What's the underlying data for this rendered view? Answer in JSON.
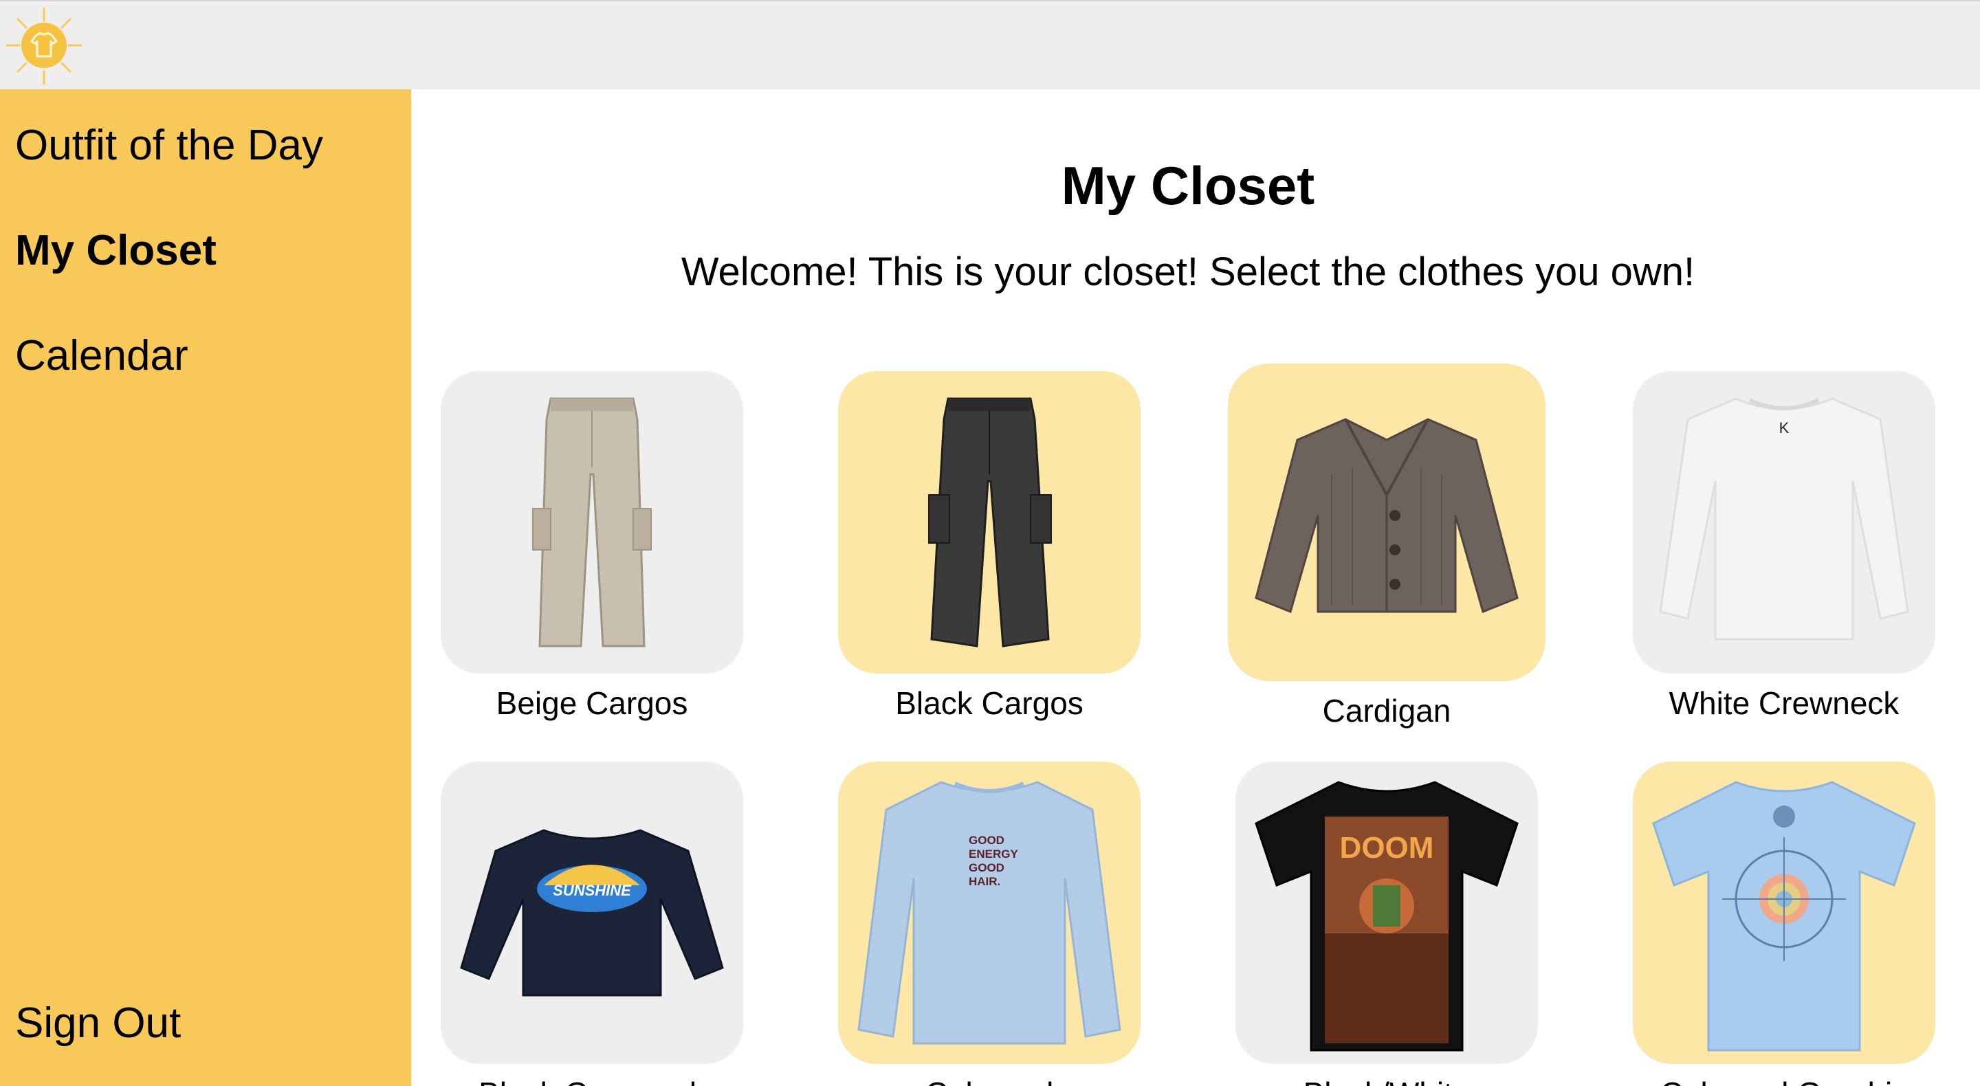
{
  "app": {
    "logo_icon": "sun-shirt-logo-icon"
  },
  "colors": {
    "sidebar": "#f8c958",
    "topbar": "#eeeeee",
    "tile_default": "#eeeeee",
    "tile_selected": "#fce7a6"
  },
  "sidebar": {
    "items": [
      {
        "label": "Outfit of the Day",
        "active": false
      },
      {
        "label": "My Closet",
        "active": true
      },
      {
        "label": "Calendar",
        "active": false
      }
    ],
    "signout_label": "Sign Out"
  },
  "main": {
    "title": "My Closet",
    "subtitle": "Welcome! This is your closet! Select the clothes you own!"
  },
  "closet": {
    "items": [
      {
        "label": "Beige Cargos",
        "selected": false,
        "icon": "beige-cargo-pants-icon"
      },
      {
        "label": "Black Cargos",
        "selected": true,
        "icon": "black-cargo-pants-icon"
      },
      {
        "label": "Cardigan",
        "selected": true,
        "icon": "brown-cardigan-icon"
      },
      {
        "label": "White Crewneck",
        "selected": false,
        "icon": "white-crewneck-icon"
      },
      {
        "label": "Black Crewneck",
        "selected": false,
        "icon": "black-crewneck-icon"
      },
      {
        "label": "Coloured",
        "selected": true,
        "icon": "blue-crewneck-icon",
        "print_text": "GOOD ENERGY GOOD HAIR."
      },
      {
        "label": "Black/White",
        "selected": false,
        "icon": "black-graphic-tee-icon",
        "print_text": "DOOM"
      },
      {
        "label": "Coloured Graphic",
        "selected": true,
        "icon": "blue-graphic-tee-icon"
      }
    ]
  }
}
